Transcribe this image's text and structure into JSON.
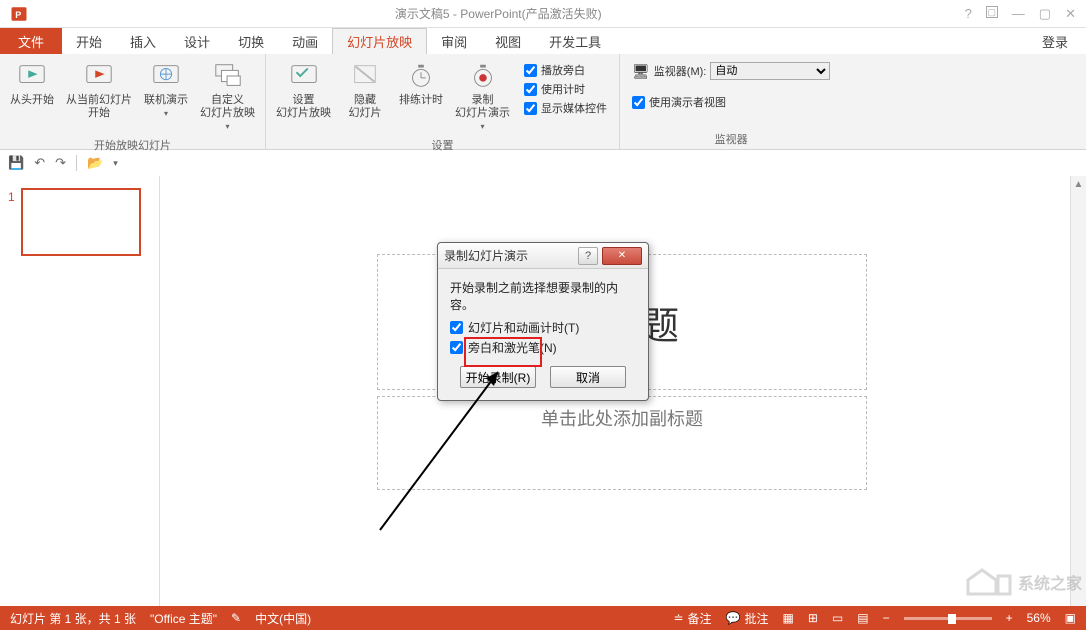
{
  "title": "演示文稿5 - PowerPoint(产品激活失败)",
  "login": "登录",
  "tabs": {
    "file": "文件",
    "home": "开始",
    "insert": "插入",
    "design": "设计",
    "transitions": "切换",
    "animations": "动画",
    "slideshow": "幻灯片放映",
    "review": "审阅",
    "view": "视图",
    "developer": "开发工具"
  },
  "ribbon": {
    "group_start": "开始放映幻灯片",
    "from_beginning": "从头开始",
    "from_current": "从当前幻灯片\n开始",
    "present_online": "联机演示",
    "custom_show": "自定义\n幻灯片放映",
    "group_setup": "设置",
    "setup_show": "设置\n幻灯片放映",
    "hide_slide": "隐藏\n幻灯片",
    "rehearse": "排练计时",
    "record": "录制\n幻灯片演示",
    "play_narrations": "播放旁白",
    "use_timings": "使用计时",
    "show_media": "显示媒体控件",
    "group_monitors": "监视器",
    "monitor_label": "监视器(M):",
    "monitor_value": "自动",
    "presenter_view": "使用演示者视图"
  },
  "slide": {
    "title_placeholder": "加标题",
    "subtitle_placeholder": "单击此处添加副标题"
  },
  "dialog": {
    "title": "录制幻灯片演示",
    "prompt": "开始录制之前选择想要录制的内容。",
    "opt_timing": "幻灯片和动画计时(T)",
    "opt_narration": "旁白和激光笔(N)",
    "start": "开始录制(R)",
    "cancel": "取消"
  },
  "status": {
    "slide_info": "幻灯片 第 1 张，共 1 张",
    "theme": "\"Office 主题\"",
    "language": "中文(中国)",
    "notes": "备注",
    "comments": "批注",
    "zoom": "56%"
  },
  "thumb": {
    "num": "1"
  },
  "watermark": "系统之家"
}
